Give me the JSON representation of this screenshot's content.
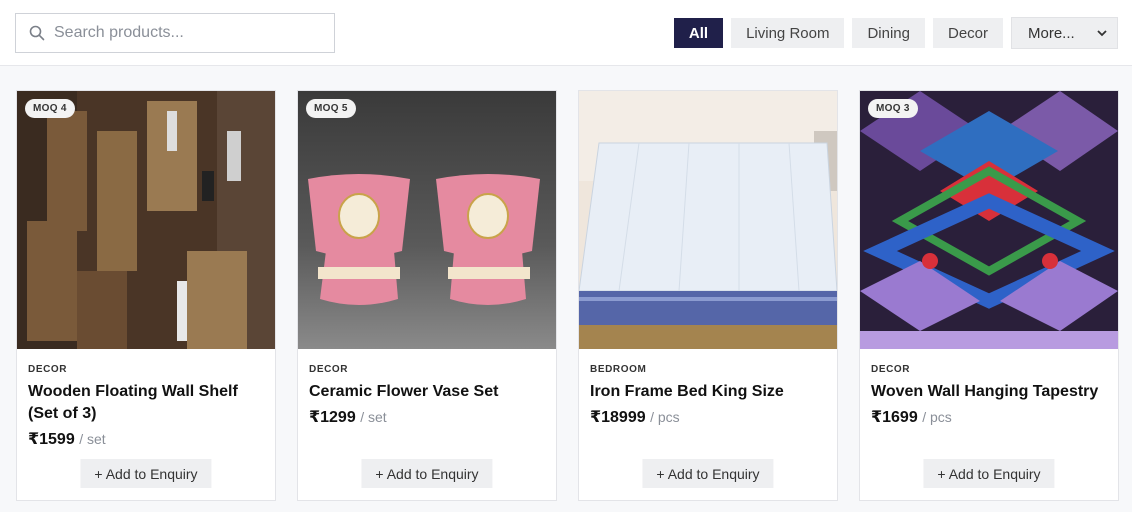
{
  "search": {
    "placeholder": "Search products...",
    "value": ""
  },
  "filters": {
    "chips": [
      "All",
      "Living Room",
      "Dining",
      "Decor"
    ],
    "active": "All",
    "more_label": "More..."
  },
  "products": [
    {
      "moq": "MOQ 4",
      "category": "DECOR",
      "title": "Wooden Floating Wall Shelf (Set of 3)",
      "price": "₹1599",
      "unit": "/ set",
      "button": "+ Add to Enquiry"
    },
    {
      "moq": "MOQ 5",
      "category": "DECOR",
      "title": "Ceramic Flower Vase Set",
      "price": "₹1299",
      "unit": "/ set",
      "button": "+ Add to Enquiry"
    },
    {
      "moq": "",
      "category": "BEDROOM",
      "title": "Iron Frame Bed King Size",
      "price": "₹18999",
      "unit": "/ pcs",
      "button": "+ Add to Enquiry"
    },
    {
      "moq": "MOQ 3",
      "category": "DECOR",
      "title": "Woven Wall Hanging Tapestry",
      "price": "₹1699",
      "unit": "/ pcs",
      "button": "+ Add to Enquiry"
    }
  ],
  "colors": {
    "accent": "#20204a",
    "chip_bg": "#eeeff1",
    "muted": "#8a8f98"
  },
  "icons": {
    "search": "search-icon",
    "dropdown": "chevron-down-icon"
  }
}
